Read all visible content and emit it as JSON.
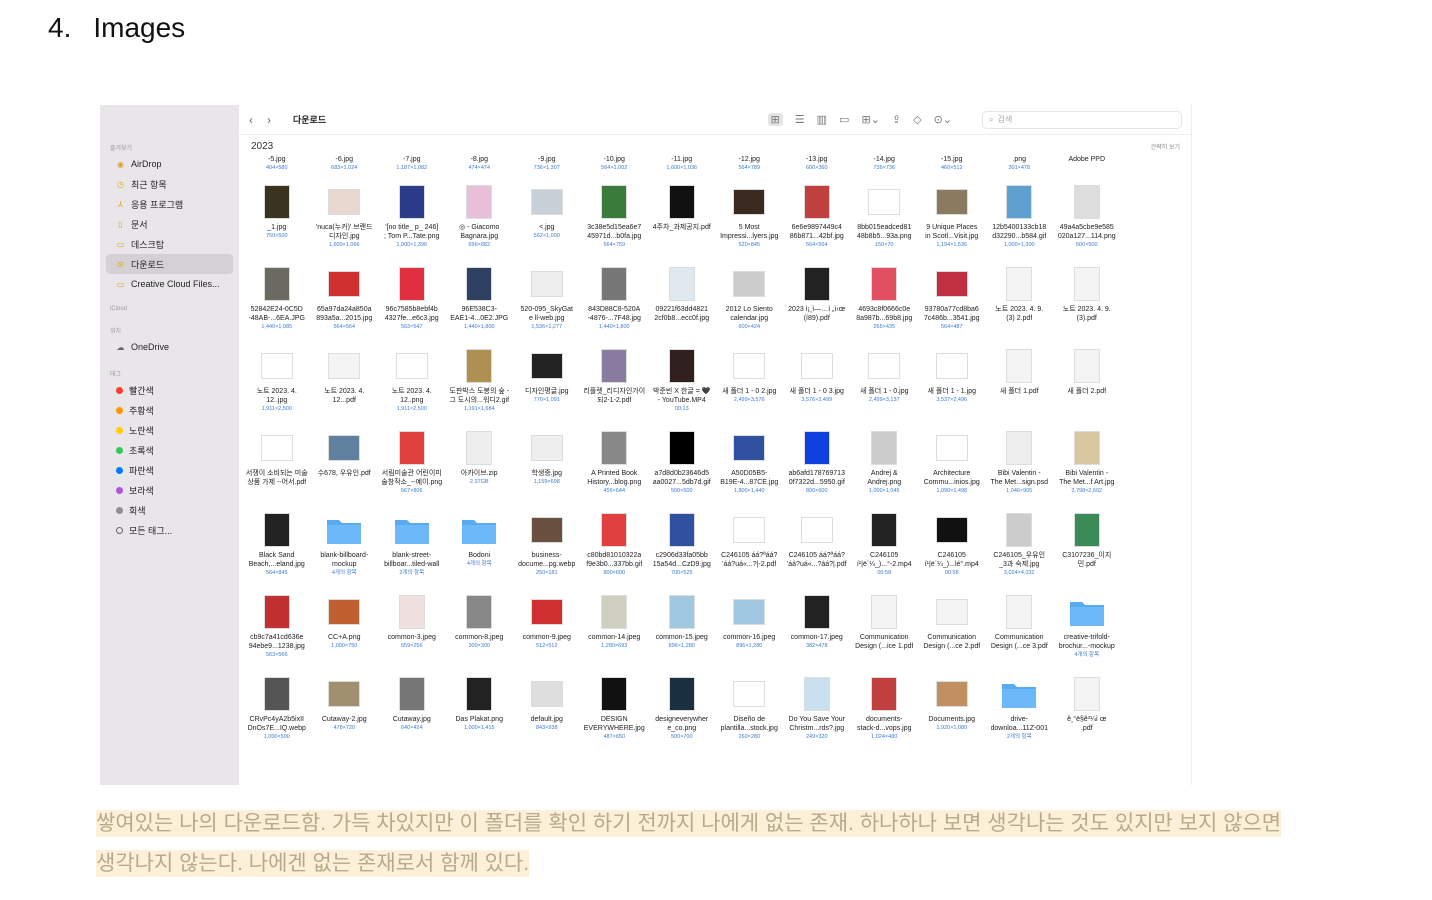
{
  "heading": {
    "number": "4.",
    "title": "Images"
  },
  "finder": {
    "toolbar": {
      "back": "‹",
      "forward": "›",
      "title": "다운로드",
      "search_placeholder": "검색"
    },
    "sidebar": {
      "favorites_label": "즐겨찾기",
      "favorites": [
        {
          "icon": "airdrop-icon",
          "label": "AirDrop"
        },
        {
          "icon": "recent-icon",
          "label": "최근 항목"
        },
        {
          "icon": "apps-icon",
          "label": "응용 프로그램"
        },
        {
          "icon": "document-icon",
          "label": "문서"
        },
        {
          "icon": "desktop-icon",
          "label": "데스크탑"
        },
        {
          "icon": "download-icon",
          "label": "다운로드"
        },
        {
          "icon": "folder-icon",
          "label": "Creative Cloud Files..."
        }
      ],
      "icloud_label": "iCloud",
      "places_label": "위치",
      "places": [
        {
          "icon": "cloud-icon",
          "label": "OneDrive"
        }
      ],
      "tags_label": "태그",
      "tags": [
        {
          "label": "빨간색",
          "color": "#ff3b30"
        },
        {
          "label": "주황색",
          "color": "#ff9500"
        },
        {
          "label": "노란색",
          "color": "#ffcc00"
        },
        {
          "label": "초록색",
          "color": "#34c759"
        },
        {
          "label": "파란색",
          "color": "#007aff"
        },
        {
          "label": "보라색",
          "color": "#af52de"
        },
        {
          "label": "회색",
          "color": "#8e8e93"
        },
        {
          "label": "모든 태그...",
          "color": ""
        }
      ]
    },
    "year": "2023",
    "show_less": "간략히 보기",
    "top_row": [
      {
        "n": "-5.jpg",
        "m": "404×580"
      },
      {
        "n": "-6.jpg",
        "m": "683×1,024"
      },
      {
        "n": "-7.jpg",
        "m": "1,187×1,082"
      },
      {
        "n": "-8.jpg",
        "m": "474×474"
      },
      {
        "n": "-9.jpg",
        "m": "736×1,307"
      },
      {
        "n": "-10.jpg",
        "m": "564×1,002"
      },
      {
        "n": "-11.jpg",
        "m": "1,600×1,036"
      },
      {
        "n": "-12.jpg",
        "m": "564×789"
      },
      {
        "n": "-13.jpg",
        "m": "600×360"
      },
      {
        "n": "-14.jpg",
        "m": "736×736"
      },
      {
        "n": "-15.jpg",
        "m": "460×512"
      },
      {
        "n": ".png",
        "m": "301×478"
      },
      {
        "n": "Adobe PPD",
        "m": ""
      },
      {
        "n": "",
        "m": ""
      }
    ],
    "rows": [
      [
        {
          "n1": "_1.jpg",
          "n2": "",
          "m": "750×500",
          "c": "#3a3320"
        },
        {
          "n1": "'nuca(누카)' 브랜드",
          "n2": "디자인.jpg",
          "m": "1,600×1,066",
          "c": "#e8d8d0"
        },
        {
          "n1": "'[no title_ p_ 246]",
          "n2": "; Tom P...Tate.png",
          "m": "1,000×1,396",
          "c": "#2a3c8a"
        },
        {
          "n1": "◎ - Giacomo",
          "n2": "Bagnara.jpg",
          "m": "696×882",
          "c": "#e8c0d8"
        },
        {
          "n1": "<.jpg",
          "n2": "",
          "m": "562×1,000",
          "c": "#c8d0d8"
        },
        {
          "n1": "3c38e5d15ea6e7",
          "n2": "45971d...b0fa.jpg",
          "m": "564×759",
          "c": "#3a7a3a"
        },
        {
          "n1": "4주차_과제공지.pdf",
          "n2": "",
          "m": "",
          "c": "#111"
        },
        {
          "n1": "5 Most",
          "n2": "Impressi...lyers.jpg",
          "m": "520×845",
          "c": "#3a2a20"
        },
        {
          "n1": "6e6e9897449c4",
          "n2": "86b871...42bf.jpg",
          "m": "564×564",
          "c": "#c04040"
        },
        {
          "n1": "8bb015eadced81",
          "n2": "48b8b5...93a.png",
          "m": "150×70",
          "c": "#fff"
        },
        {
          "n1": "9 Unique Places",
          "n2": "in Scotl...Visit.jpg",
          "m": "1,194×1,536",
          "c": "#8a7a60"
        },
        {
          "n1": "12b5400133cb18",
          "n2": "d32290...b584.gif",
          "m": "1,000×1,300",
          "c": "#60a0d0"
        },
        {
          "n1": "49a4a5cbe9e585",
          "n2": "020a127...114.png",
          "m": "500×500",
          "c": "#ddd"
        },
        {
          "n1": "",
          "n2": "",
          "m": "",
          "c": ""
        }
      ],
      [
        {
          "n1": "52842E24-0C5D",
          "n2": "-48AB-...6EA.JPG",
          "m": "1,440×1,085",
          "c": "#6a6a60"
        },
        {
          "n1": "65a97da24a850a",
          "n2": "893a5a...2015.jpg",
          "m": "564×564",
          "c": "#d03030"
        },
        {
          "n1": "96c7585b8ebf4b",
          "n2": "4327fe...e6c3.jpg",
          "m": "563×547",
          "c": "#e03040"
        },
        {
          "n1": "96E538C3-",
          "n2": "EAE1-4...0E2.JPG",
          "m": "1,440×1,800",
          "c": "#304060"
        },
        {
          "n1": "520-095_SkyGat",
          "n2": "e ll-web.jpg",
          "m": "1,536×1,277",
          "c": "#eee"
        },
        {
          "n1": "843D88C8-520A",
          "n2": "-4876-...7F48.jpg",
          "m": "1,440×1,800",
          "c": "#777"
        },
        {
          "n1": "09221f63dd4821",
          "n2": "2cf0b8...ecc0f.jpg",
          "m": "",
          "c": "#e0e8f0"
        },
        {
          "n1": "2012 Lo Siento",
          "n2": "calendar.jpg",
          "m": "600×424",
          "c": "#ccc"
        },
        {
          "n1": "2023 ì¡¸ì—…ì „ì‹œ",
          "n2": "(í89).pdf",
          "m": "",
          "c": "#222"
        },
        {
          "n1": "4693c8f0666c0e",
          "n2": "8a987b...69b8.jpg",
          "m": "265×435",
          "c": "#e05060"
        },
        {
          "n1": "93780a77cd8ba6",
          "n2": "7c486b...3541.jpg",
          "m": "564×487",
          "c": "#c03040"
        },
        {
          "n1": "노트 2023. 4. 9.",
          "n2": "(3) 2.pdf",
          "m": "",
          "c": "#f4f4f4"
        },
        {
          "n1": "노트 2023. 4. 9.",
          "n2": "(3).pdf",
          "m": "",
          "c": "#f4f4f4"
        },
        {
          "n1": "",
          "n2": "",
          "m": "",
          "c": ""
        }
      ],
      [
        {
          "n1": "노트 2023. 4.",
          "n2": "12..jpg",
          "m": "1,911×2,500",
          "c": "#fff"
        },
        {
          "n1": "노트 2023. 4.",
          "n2": "12...pdf",
          "m": "",
          "c": "#f4f4f4"
        },
        {
          "n1": "노트 2023. 4.",
          "n2": "12..png",
          "m": "1,911×2,500",
          "c": "#fff"
        },
        {
          "n1": "도판박스 도봉의 숲 -",
          "n2": "그 도시의...워디2.gif",
          "m": "1,191×1,684",
          "c": "#b09050"
        },
        {
          "n1": "디자인평글.jpg",
          "n2": "",
          "m": "770×1,091",
          "c": "#222"
        },
        {
          "n1": "리플렛_리디자인가이",
          "n2": "되2-1-2.pdf",
          "m": "",
          "c": "#8a7aa0"
        },
        {
          "n1": "박준빈 X 한글 = 🖤",
          "n2": "- YouTube.MP4",
          "m": "00:13",
          "c": "#302020"
        },
        {
          "n1": "새 폴더 1 - 0 2.jpg",
          "n2": "",
          "m": "2,499×3,576",
          "c": "#fff"
        },
        {
          "n1": "새 폴더 1 - 0 3.jpg",
          "n2": "",
          "m": "3,576×2,499",
          "c": "#fff"
        },
        {
          "n1": "새 폴더 1 - 0.jpg",
          "n2": "",
          "m": "2,499×3,137",
          "c": "#fff"
        },
        {
          "n1": "새 폴더 1 - 1.jpg",
          "n2": "",
          "m": "3,537×2,496",
          "c": "#fff"
        },
        {
          "n1": "새 폴더 1.pdf",
          "n2": "",
          "m": "",
          "c": "#f4f4f4"
        },
        {
          "n1": "새 폴더 2.pdf",
          "n2": "",
          "m": "",
          "c": "#f4f4f4"
        },
        {
          "n1": "",
          "n2": "",
          "m": "",
          "c": ""
        }
      ],
      [
        {
          "n1": "서쟁이 소비되는 미술",
          "n2": "상품 가제 --어서.pdf",
          "m": "",
          "c": "#fff"
        },
        {
          "n1": "수678, 우유인.pdf",
          "n2": "",
          "m": "",
          "c": "#6080a0"
        },
        {
          "n1": "서림미술관 어린이미",
          "n2": "술창작소_--예이.png",
          "m": "567×806",
          "c": "#e04040"
        },
        {
          "n1": "아카이브.zip",
          "n2": "",
          "m": "2.37GB",
          "c": "#eee"
        },
        {
          "n1": "학생증.jpg",
          "n2": "",
          "m": "1,159×698",
          "c": "#eee"
        },
        {
          "n1": "A Printed Book",
          "n2": "History...blog.png",
          "m": "456×644",
          "c": "#888"
        },
        {
          "n1": "a7d8d0b23646d5",
          "n2": "aa0027...5db7d.gif",
          "m": "500×500",
          "c": "#000"
        },
        {
          "n1": "A50D05B5-",
          "n2": "B19E-4...87CE.jpg",
          "m": "1,800×1,440",
          "c": "#3050a0"
        },
        {
          "n1": "ab6afd178769713",
          "n2": "0f7322d...5950.gif",
          "m": "800×600",
          "c": "#1040e0"
        },
        {
          "n1": "Andrej &",
          "n2": "Andrej.png",
          "m": "1,000×1,045",
          "c": "#ccc"
        },
        {
          "n1": "Architecture",
          "n2": "Commu...inios.jpg",
          "m": "1,090×1,498",
          "c": "#fff"
        },
        {
          "n1": "Bibi Valentin -",
          "n2": "The Met...sign.psd",
          "m": "1,046×905",
          "c": "#eee"
        },
        {
          "n1": "Bibi Valentin -",
          "n2": "The Met...f Art.jpg",
          "m": "3,798×2,602",
          "c": "#d8c8a0"
        },
        {
          "n1": "",
          "n2": "",
          "m": "",
          "c": ""
        }
      ],
      [
        {
          "n1": "Black Sand",
          "n2": "Beach,...eland.jpg",
          "m": "564×845",
          "c": "#222"
        },
        {
          "n1": "blank-billboard-",
          "n2": "mockup",
          "m": "4개의 항목",
          "c": "folder"
        },
        {
          "n1": "blank-street-",
          "n2": "billboar...tiled-wall",
          "m": "2개의 항목",
          "c": "folder"
        },
        {
          "n1": "Bodoni",
          "n2": "",
          "m": "4개의 항목",
          "c": "folder"
        },
        {
          "n1": "business-",
          "n2": "docume...pg.webp",
          "m": "250×181",
          "c": "#6a5040"
        },
        {
          "n1": "c80bd81010322a",
          "n2": "f9e3b0...337bb.gif",
          "m": "800×600",
          "c": "#e04040"
        },
        {
          "n1": "c2906d33fa05bb",
          "n2": "15a54d...CzD9.jpg",
          "m": "700×525",
          "c": "#3050a0"
        },
        {
          "n1": "C246105 áá?ªáá?",
          "n2": "'áá?uá«...?|-2.pdf",
          "m": "",
          "c": "#fff"
        },
        {
          "n1": "C246105 áá?ªáá?",
          "n2": "'áá?uá«...?áá?|.pdf",
          "m": "",
          "c": "#fff"
        },
        {
          "n1": "C246105",
          "n2": "í¹|ë´¼_)...°-2.mp4",
          "m": "00:58",
          "c": "#222"
        },
        {
          "n1": "C246105",
          "n2": "í¹|ë´¼_)...lé°.mp4",
          "m": "00:58",
          "c": "#111"
        },
        {
          "n1": "C246105_우유인",
          "n2": "_3과 숙제.jpg",
          "m": "3,024×4,032",
          "c": "#ccc"
        },
        {
          "n1": "C3107236_이지",
          "n2": "민.pdf",
          "m": "",
          "c": "#3a8a5a"
        },
        {
          "n1": "",
          "n2": "",
          "m": "",
          "c": ""
        }
      ],
      [
        {
          "n1": "cb9c7a41cd636e",
          "n2": "94ebe9...1238.jpg",
          "m": "563×566",
          "c": "#c03030"
        },
        {
          "n1": "CC+A.png",
          "n2": "",
          "m": "1,000×750",
          "c": "#c06030"
        },
        {
          "n1": "common-3.jpeg",
          "n2": "",
          "m": "659×256",
          "c": "#f0e0e0"
        },
        {
          "n1": "common-8.jpeg",
          "n2": "",
          "m": "300×300",
          "c": "#888"
        },
        {
          "n1": "common-9.jpeg",
          "n2": "",
          "m": "512×512",
          "c": "#d03030"
        },
        {
          "n1": "common-14.jpeg",
          "n2": "",
          "m": "1,280×693",
          "c": "#d0d0c0"
        },
        {
          "n1": "common-15.jpeg",
          "n2": "",
          "m": "896×1,280",
          "c": "#a0c8e0"
        },
        {
          "n1": "common-16.jpeg",
          "n2": "",
          "m": "896×1,280",
          "c": "#a0c8e0"
        },
        {
          "n1": "common-17.jpeg",
          "n2": "",
          "m": "382×478",
          "c": "#222"
        },
        {
          "n1": "Communication",
          "n2": "Design (...ice 1.pdf",
          "m": "",
          "c": "#f4f4f4"
        },
        {
          "n1": "Communication",
          "n2": "Design (...ce 2.pdf",
          "m": "",
          "c": "#f4f4f4"
        },
        {
          "n1": "Communication",
          "n2": "Design (...ce 3.pdf",
          "m": "",
          "c": "#f4f4f4"
        },
        {
          "n1": "creative-trifold-",
          "n2": "brochur...-mockup",
          "m": "4개의 항목",
          "c": "folder"
        },
        {
          "n1": "",
          "n2": "",
          "m": "",
          "c": ""
        }
      ],
      [
        {
          "n1": "CRvPc4yA2b5ixII",
          "n2": "DnOs7E...IQ.webp",
          "m": "1,000×500",
          "c": "#555"
        },
        {
          "n1": "Cutaway-2.jpg",
          "n2": "",
          "m": "478×720",
          "c": "#a09070"
        },
        {
          "n1": "Cutaway.jpg",
          "n2": "",
          "m": "640×424",
          "c": "#777"
        },
        {
          "n1": "Das Plakat.png",
          "n2": "",
          "m": "1,000×1,415",
          "c": "#222"
        },
        {
          "n1": "default.jpg",
          "n2": "",
          "m": "843×938",
          "c": "#ddd"
        },
        {
          "n1": "DESIGN",
          "n2": "EVERYWHERE.jpg",
          "m": "487×650",
          "c": "#111"
        },
        {
          "n1": "designeverywher",
          "n2": "e_co.png",
          "m": "500×700",
          "c": "#1a3040"
        },
        {
          "n1": "Diseño de",
          "n2": "plantilla...stock.jpg",
          "m": "260×280",
          "c": "#fff"
        },
        {
          "n1": "Do You Save Your",
          "n2": "Christm...rds?.jpg",
          "m": "249×320",
          "c": "#c8e0f0"
        },
        {
          "n1": "documents-",
          "n2": "stack-d...vops.jpg",
          "m": "1,024×480",
          "c": "#c04040"
        },
        {
          "n1": "Documents.jpg",
          "n2": "",
          "m": "1,920×1,080",
          "c": "#c09060"
        },
        {
          "n1": "drive-",
          "n2": "downloa...11Z-001",
          "m": "2개의 항목",
          "c": "folder"
        },
        {
          "n1": "ê¸°ë§ê³¼ì œ",
          "n2": ".pdf",
          "m": "",
          "c": "#f4f4f4"
        },
        {
          "n1": "",
          "n2": "",
          "m": "",
          "c": ""
        }
      ]
    ]
  },
  "caption": {
    "line1": "쌓여있는 나의 다운로드함. 가득 차있지만 이 폴더를 확인 하기 전까지 나에게 없는 존재. 하나하나 보면 생각나는 것도 있지만 보지 않으면",
    "line2": "생각나지 않는다. 나에겐 없는 존재로서 함께 있다."
  }
}
